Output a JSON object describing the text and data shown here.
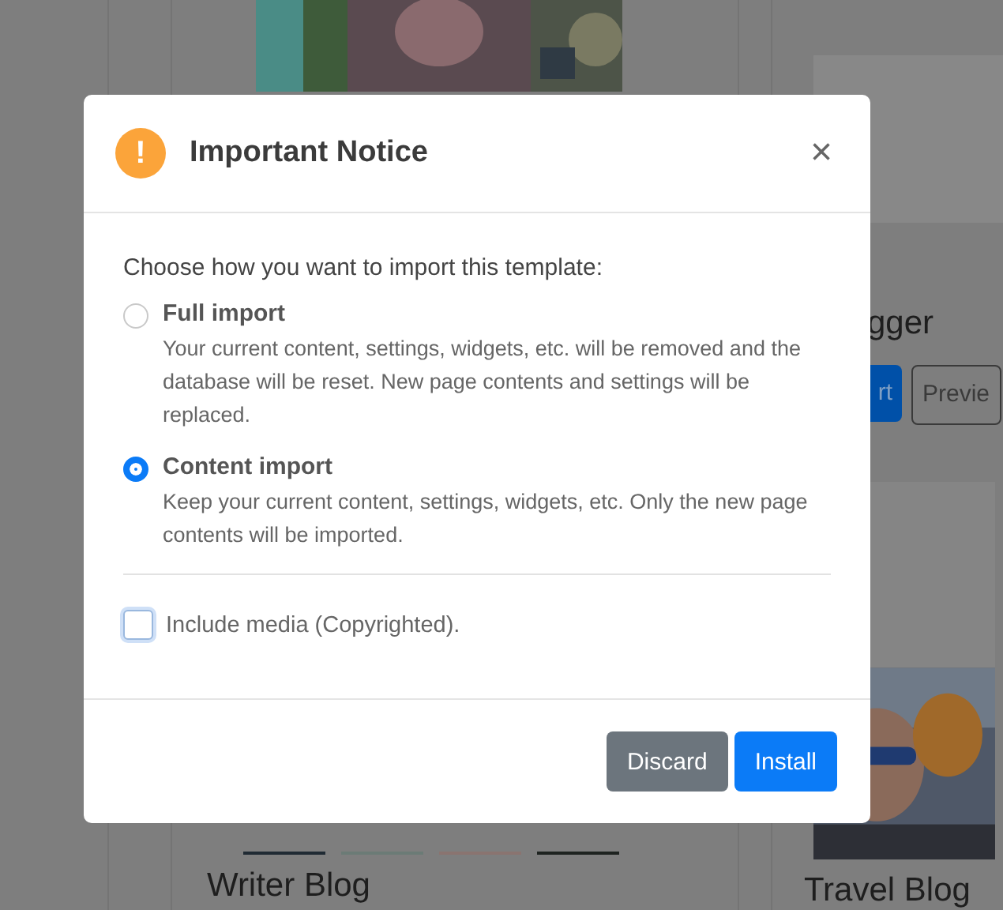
{
  "background": {
    "cards": [
      {
        "title": "Writer Blog"
      },
      {
        "title": "Travel Blog"
      }
    ],
    "partial_card": {
      "title": "gger",
      "buttons": [
        {
          "label": "rt",
          "kind": "primary"
        },
        {
          "label": "Previe",
          "kind": "outline"
        }
      ]
    }
  },
  "modal": {
    "title": "Important Notice",
    "icon": "!",
    "close": "×",
    "prompt": "Choose how you want to import this template:",
    "options": [
      {
        "label": "Full import",
        "description": "Your current content, settings, widgets, etc. will be removed and the database will be reset. New page contents and settings will be replaced.",
        "selected": false
      },
      {
        "label": "Content import",
        "description": "Keep your current content, settings, widgets, etc. Only the new page contents will be imported.",
        "selected": true
      }
    ],
    "include_media": {
      "label": "Include media (Copyrighted).",
      "checked": false
    },
    "buttons": [
      {
        "label": "Discard",
        "kind": "secondary"
      },
      {
        "label": "Install",
        "kind": "primary"
      }
    ]
  }
}
